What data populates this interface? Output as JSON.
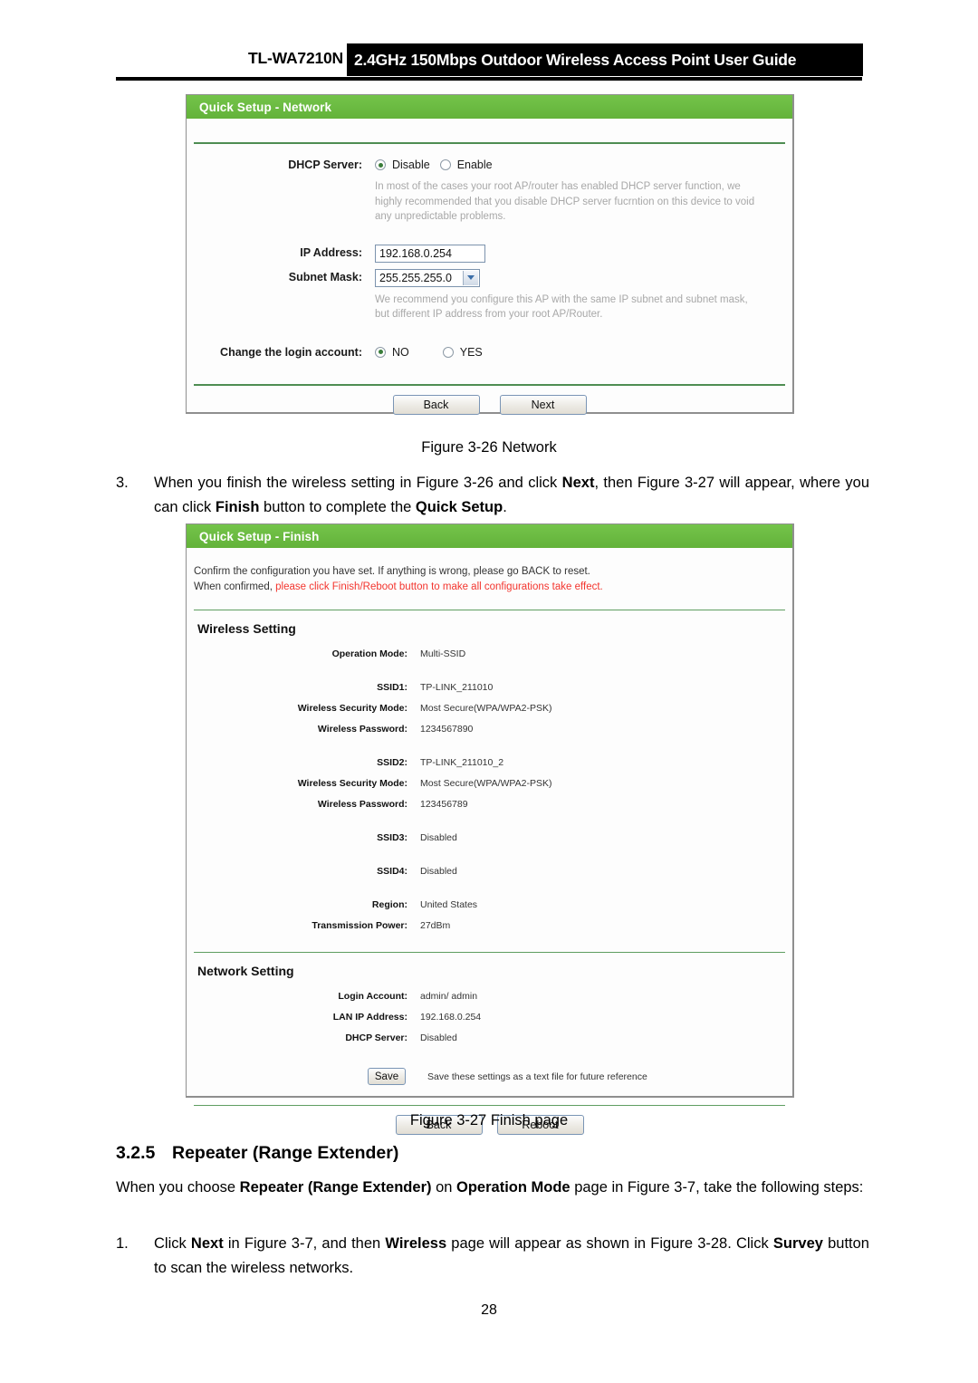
{
  "header": {
    "model": "TL-WA7210N",
    "title": "2.4GHz 150Mbps Outdoor Wireless Access Point User Guide"
  },
  "network_panel": {
    "titlebar": "Quick Setup - Network",
    "dhcp": {
      "label": "DHCP Server:",
      "options": [
        "Disable",
        "Enable"
      ],
      "selected": "Disable",
      "hint": "In most of the cases your root AP/router has enabled DHCP server function, we highly recommended that you disable DHCP server fucrntion on this device to void any unpredictable problems."
    },
    "ip_address": {
      "label": "IP Address:",
      "value": "192.168.0.254"
    },
    "subnet_mask": {
      "label": "Subnet Mask:",
      "value": "255.255.255.0",
      "hint": "We recommend you configure this AP with the same IP subnet and subnet mask, but different IP address from your root AP/Router."
    },
    "change_login": {
      "label": "Change the login account:",
      "options": [
        "NO",
        "YES"
      ],
      "selected": "NO"
    },
    "buttons": {
      "back": "Back",
      "next": "Next"
    }
  },
  "figure_26_caption": "Figure 3-26 Network",
  "step3": {
    "number": "3.",
    "part1": "When you finish the wireless setting in Figure 3-26 and click ",
    "bold1": "Next",
    "part2": ", then Figure 3-27 will appear, where you can click ",
    "bold2": "Finish",
    "part3": " button to complete the ",
    "bold3": "Quick Setup",
    "part4": "."
  },
  "finish_panel": {
    "titlebar": "Quick Setup - Finish",
    "notice_line1": "Confirm the configuration you have set. If anything is wrong, please go BACK to reset.",
    "notice_line2_plain": "When confirmed, ",
    "notice_line2_red": "please click Finish/Reboot button to make all configurations take effect.",
    "wireless_setting_title": "Wireless Setting",
    "wireless_rows_group1": [
      {
        "label": "Operation Mode:",
        "value": "Multi-SSID"
      }
    ],
    "wireless_rows_group2": [
      {
        "label": "SSID1:",
        "value": "TP-LINK_211010"
      },
      {
        "label": "Wireless Security Mode:",
        "value": "Most Secure(WPA/WPA2-PSK)"
      },
      {
        "label": "Wireless Password:",
        "value": "1234567890"
      }
    ],
    "wireless_rows_group3": [
      {
        "label": "SSID2:",
        "value": "TP-LINK_211010_2"
      },
      {
        "label": "Wireless Security Mode:",
        "value": "Most Secure(WPA/WPA2-PSK)"
      },
      {
        "label": "Wireless Password:",
        "value": "123456789"
      }
    ],
    "wireless_rows_group4": [
      {
        "label": "SSID3:",
        "value": "Disabled"
      }
    ],
    "wireless_rows_group5": [
      {
        "label": "SSID4:",
        "value": "Disabled"
      }
    ],
    "wireless_rows_group6": [
      {
        "label": "Region:",
        "value": "United States"
      },
      {
        "label": "Transmission Power:",
        "value": "27dBm"
      }
    ],
    "network_setting_title": "Network Setting",
    "network_rows": [
      {
        "label": "Login Account:",
        "value": "admin/ admin"
      },
      {
        "label": "LAN IP Address:",
        "value": "192.168.0.254"
      },
      {
        "label": "DHCP Server:",
        "value": "Disabled"
      }
    ],
    "save_button": "Save",
    "save_note": "Save these settings as a text file for future reference",
    "buttons": {
      "back": "Back",
      "reboot": "Reboot"
    }
  },
  "figure_27_caption": "Figure 3-27 Finish page",
  "section": {
    "number": "3.2.5",
    "title": "Repeater (Range Extender)"
  },
  "intro": {
    "part1": "When you choose ",
    "bold1": "Repeater (Range Extender)",
    "part2": " on ",
    "bold2": "Operation Mode",
    "part3": " page in Figure 3-7, take the following steps:"
  },
  "step1": {
    "number": "1.",
    "part1": "Click ",
    "bold1": "Next",
    "part2": " in Figure 3-7, and then ",
    "bold2": "Wireless",
    "part3": " page will appear as shown in Figure 3-28. Click ",
    "bold3": "Survey",
    "part4": " button to scan the wireless networks."
  },
  "page_number": "28",
  "colors": {
    "panel_green": "#6fbf44",
    "notice_red": "#f3352e",
    "rule_green": "#4e8d52"
  }
}
